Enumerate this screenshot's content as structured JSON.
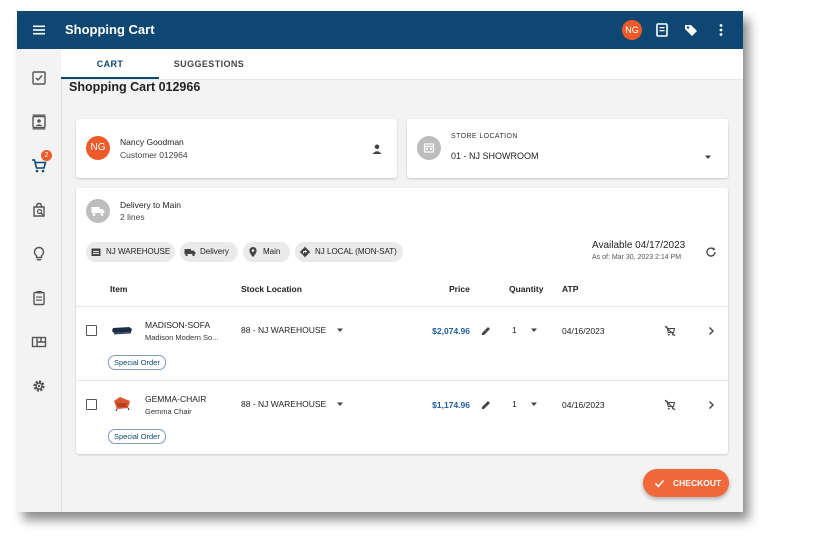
{
  "app": {
    "title": "Shopping Cart",
    "user_initials": "NG",
    "colors": {
      "primary": "#0e4872",
      "accent": "#ee5a2a",
      "link": "#1f5d96"
    },
    "icons": [
      "menu-icon",
      "receipt-icon",
      "tag-icon",
      "more-vert-icon"
    ]
  },
  "sidebar": {
    "items": [
      {
        "icon": "checklist-icon"
      },
      {
        "icon": "contacts-icon"
      },
      {
        "icon": "cart-icon",
        "badge": "2"
      },
      {
        "icon": "search-orders-icon"
      },
      {
        "icon": "lightbulb-icon"
      },
      {
        "icon": "clipboard-icon"
      },
      {
        "icon": "dashboard-icon"
      },
      {
        "icon": "settings-icon"
      }
    ]
  },
  "tabs": [
    {
      "label": "CART",
      "active": true
    },
    {
      "label": "SUGGESTIONS",
      "active": false
    }
  ],
  "page_title": "Shopping Cart 012966",
  "customer": {
    "initials": "NG",
    "name": "Nancy Goodman",
    "id_text": "Customer 012964"
  },
  "store": {
    "label": "STORE LOCATION",
    "value": "01 - NJ SHOWROOM"
  },
  "delivery": {
    "title": "Delivery to Main",
    "lines": "2 lines",
    "chips": [
      "NJ WAREHOUSE",
      "Delivery",
      "Main",
      "NJ LOCAL (MON-SAT)"
    ],
    "available": "Available 04/17/2023",
    "as_of": "As of: Mar 30, 2023 2:14 PM"
  },
  "table": {
    "headers": {
      "item": "Item",
      "stock": "Stock Location",
      "price": "Price",
      "qty": "Quantity",
      "atp": "ATP"
    },
    "rows": [
      {
        "name": "MADISON-SOFA",
        "desc": "Madison Modern So...",
        "stock": "88 - NJ WAREHOUSE",
        "price": "$2,074.96",
        "qty": "1",
        "atp": "04/16/2023",
        "tag": "Special Order"
      },
      {
        "name": "GEMMA-CHAIR",
        "desc": "Gemma Chair",
        "stock": "88 - NJ WAREHOUSE",
        "price": "$1,174.96",
        "qty": "1",
        "atp": "04/16/2023",
        "tag": "Special Order"
      }
    ]
  },
  "checkout": {
    "label": "CHECKOUT"
  }
}
